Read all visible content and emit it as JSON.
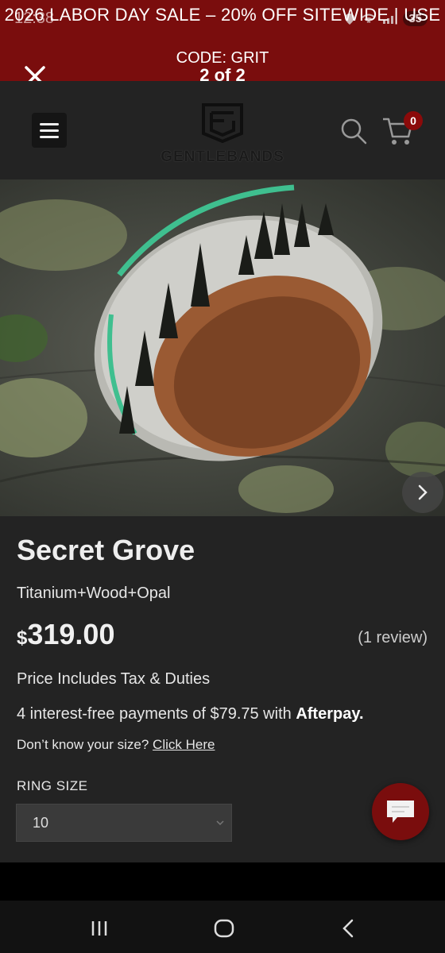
{
  "status_bar": {
    "time": "12:38",
    "battery": "35"
  },
  "promo": {
    "line1": "2026 LABOR DAY SALE – 20% OFF SITEWIDE | USE",
    "line2": "CODE: GRIT"
  },
  "gallery": {
    "counter": "2 of 2"
  },
  "header": {
    "logo_text": "GENTLEBANDS",
    "cart_count": "0"
  },
  "product": {
    "title": "Secret Grove",
    "material": "Titanium+Wood+Opal",
    "price_currency": "$",
    "price_amount": "319.00",
    "reviews": "(1 review)",
    "tax_note": "Price Includes Tax & Duties",
    "afterpay_text": "4 interest-free payments of $79.75 with",
    "afterpay_brand": "Afterpay.",
    "size_help_text": "Don’t know your size?",
    "size_help_link": "Click Here",
    "size_label": "RING SIZE",
    "size_value": "10"
  },
  "colors": {
    "brand_red": "#7a0d0d",
    "background": "#232323",
    "opal_inlay": "#3fbf8f"
  }
}
